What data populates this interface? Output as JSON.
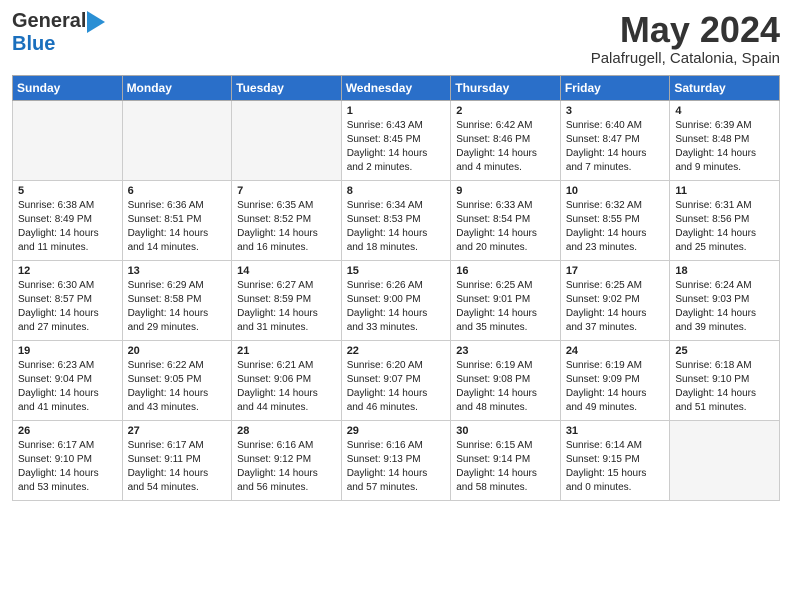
{
  "header": {
    "logo_general": "General",
    "logo_blue": "Blue",
    "title": "May 2024",
    "location": "Palafrugell, Catalonia, Spain"
  },
  "weekdays": [
    "Sunday",
    "Monday",
    "Tuesday",
    "Wednesday",
    "Thursday",
    "Friday",
    "Saturday"
  ],
  "weeks": [
    [
      {
        "day": "",
        "sunrise": "",
        "sunset": "",
        "daylight": "",
        "shaded": true
      },
      {
        "day": "",
        "sunrise": "",
        "sunset": "",
        "daylight": "",
        "shaded": true
      },
      {
        "day": "",
        "sunrise": "",
        "sunset": "",
        "daylight": "",
        "shaded": true
      },
      {
        "day": "1",
        "sunrise": "Sunrise: 6:43 AM",
        "sunset": "Sunset: 8:45 PM",
        "daylight": "Daylight: 14 hours and 2 minutes.",
        "shaded": false
      },
      {
        "day": "2",
        "sunrise": "Sunrise: 6:42 AM",
        "sunset": "Sunset: 8:46 PM",
        "daylight": "Daylight: 14 hours and 4 minutes.",
        "shaded": false
      },
      {
        "day": "3",
        "sunrise": "Sunrise: 6:40 AM",
        "sunset": "Sunset: 8:47 PM",
        "daylight": "Daylight: 14 hours and 7 minutes.",
        "shaded": false
      },
      {
        "day": "4",
        "sunrise": "Sunrise: 6:39 AM",
        "sunset": "Sunset: 8:48 PM",
        "daylight": "Daylight: 14 hours and 9 minutes.",
        "shaded": false
      }
    ],
    [
      {
        "day": "5",
        "sunrise": "Sunrise: 6:38 AM",
        "sunset": "Sunset: 8:49 PM",
        "daylight": "Daylight: 14 hours and 11 minutes.",
        "shaded": false
      },
      {
        "day": "6",
        "sunrise": "Sunrise: 6:36 AM",
        "sunset": "Sunset: 8:51 PM",
        "daylight": "Daylight: 14 hours and 14 minutes.",
        "shaded": false
      },
      {
        "day": "7",
        "sunrise": "Sunrise: 6:35 AM",
        "sunset": "Sunset: 8:52 PM",
        "daylight": "Daylight: 14 hours and 16 minutes.",
        "shaded": false
      },
      {
        "day": "8",
        "sunrise": "Sunrise: 6:34 AM",
        "sunset": "Sunset: 8:53 PM",
        "daylight": "Daylight: 14 hours and 18 minutes.",
        "shaded": false
      },
      {
        "day": "9",
        "sunrise": "Sunrise: 6:33 AM",
        "sunset": "Sunset: 8:54 PM",
        "daylight": "Daylight: 14 hours and 20 minutes.",
        "shaded": false
      },
      {
        "day": "10",
        "sunrise": "Sunrise: 6:32 AM",
        "sunset": "Sunset: 8:55 PM",
        "daylight": "Daylight: 14 hours and 23 minutes.",
        "shaded": false
      },
      {
        "day": "11",
        "sunrise": "Sunrise: 6:31 AM",
        "sunset": "Sunset: 8:56 PM",
        "daylight": "Daylight: 14 hours and 25 minutes.",
        "shaded": false
      }
    ],
    [
      {
        "day": "12",
        "sunrise": "Sunrise: 6:30 AM",
        "sunset": "Sunset: 8:57 PM",
        "daylight": "Daylight: 14 hours and 27 minutes.",
        "shaded": false
      },
      {
        "day": "13",
        "sunrise": "Sunrise: 6:29 AM",
        "sunset": "Sunset: 8:58 PM",
        "daylight": "Daylight: 14 hours and 29 minutes.",
        "shaded": false
      },
      {
        "day": "14",
        "sunrise": "Sunrise: 6:27 AM",
        "sunset": "Sunset: 8:59 PM",
        "daylight": "Daylight: 14 hours and 31 minutes.",
        "shaded": false
      },
      {
        "day": "15",
        "sunrise": "Sunrise: 6:26 AM",
        "sunset": "Sunset: 9:00 PM",
        "daylight": "Daylight: 14 hours and 33 minutes.",
        "shaded": false
      },
      {
        "day": "16",
        "sunrise": "Sunrise: 6:25 AM",
        "sunset": "Sunset: 9:01 PM",
        "daylight": "Daylight: 14 hours and 35 minutes.",
        "shaded": false
      },
      {
        "day": "17",
        "sunrise": "Sunrise: 6:25 AM",
        "sunset": "Sunset: 9:02 PM",
        "daylight": "Daylight: 14 hours and 37 minutes.",
        "shaded": false
      },
      {
        "day": "18",
        "sunrise": "Sunrise: 6:24 AM",
        "sunset": "Sunset: 9:03 PM",
        "daylight": "Daylight: 14 hours and 39 minutes.",
        "shaded": false
      }
    ],
    [
      {
        "day": "19",
        "sunrise": "Sunrise: 6:23 AM",
        "sunset": "Sunset: 9:04 PM",
        "daylight": "Daylight: 14 hours and 41 minutes.",
        "shaded": false
      },
      {
        "day": "20",
        "sunrise": "Sunrise: 6:22 AM",
        "sunset": "Sunset: 9:05 PM",
        "daylight": "Daylight: 14 hours and 43 minutes.",
        "shaded": false
      },
      {
        "day": "21",
        "sunrise": "Sunrise: 6:21 AM",
        "sunset": "Sunset: 9:06 PM",
        "daylight": "Daylight: 14 hours and 44 minutes.",
        "shaded": false
      },
      {
        "day": "22",
        "sunrise": "Sunrise: 6:20 AM",
        "sunset": "Sunset: 9:07 PM",
        "daylight": "Daylight: 14 hours and 46 minutes.",
        "shaded": false
      },
      {
        "day": "23",
        "sunrise": "Sunrise: 6:19 AM",
        "sunset": "Sunset: 9:08 PM",
        "daylight": "Daylight: 14 hours and 48 minutes.",
        "shaded": false
      },
      {
        "day": "24",
        "sunrise": "Sunrise: 6:19 AM",
        "sunset": "Sunset: 9:09 PM",
        "daylight": "Daylight: 14 hours and 49 minutes.",
        "shaded": false
      },
      {
        "day": "25",
        "sunrise": "Sunrise: 6:18 AM",
        "sunset": "Sunset: 9:10 PM",
        "daylight": "Daylight: 14 hours and 51 minutes.",
        "shaded": false
      }
    ],
    [
      {
        "day": "26",
        "sunrise": "Sunrise: 6:17 AM",
        "sunset": "Sunset: 9:10 PM",
        "daylight": "Daylight: 14 hours and 53 minutes.",
        "shaded": false
      },
      {
        "day": "27",
        "sunrise": "Sunrise: 6:17 AM",
        "sunset": "Sunset: 9:11 PM",
        "daylight": "Daylight: 14 hours and 54 minutes.",
        "shaded": false
      },
      {
        "day": "28",
        "sunrise": "Sunrise: 6:16 AM",
        "sunset": "Sunset: 9:12 PM",
        "daylight": "Daylight: 14 hours and 56 minutes.",
        "shaded": false
      },
      {
        "day": "29",
        "sunrise": "Sunrise: 6:16 AM",
        "sunset": "Sunset: 9:13 PM",
        "daylight": "Daylight: 14 hours and 57 minutes.",
        "shaded": false
      },
      {
        "day": "30",
        "sunrise": "Sunrise: 6:15 AM",
        "sunset": "Sunset: 9:14 PM",
        "daylight": "Daylight: 14 hours and 58 minutes.",
        "shaded": false
      },
      {
        "day": "31",
        "sunrise": "Sunrise: 6:14 AM",
        "sunset": "Sunset: 9:15 PM",
        "daylight": "Daylight: 15 hours and 0 minutes.",
        "shaded": false
      },
      {
        "day": "",
        "sunrise": "",
        "sunset": "",
        "daylight": "",
        "shaded": true
      }
    ]
  ]
}
